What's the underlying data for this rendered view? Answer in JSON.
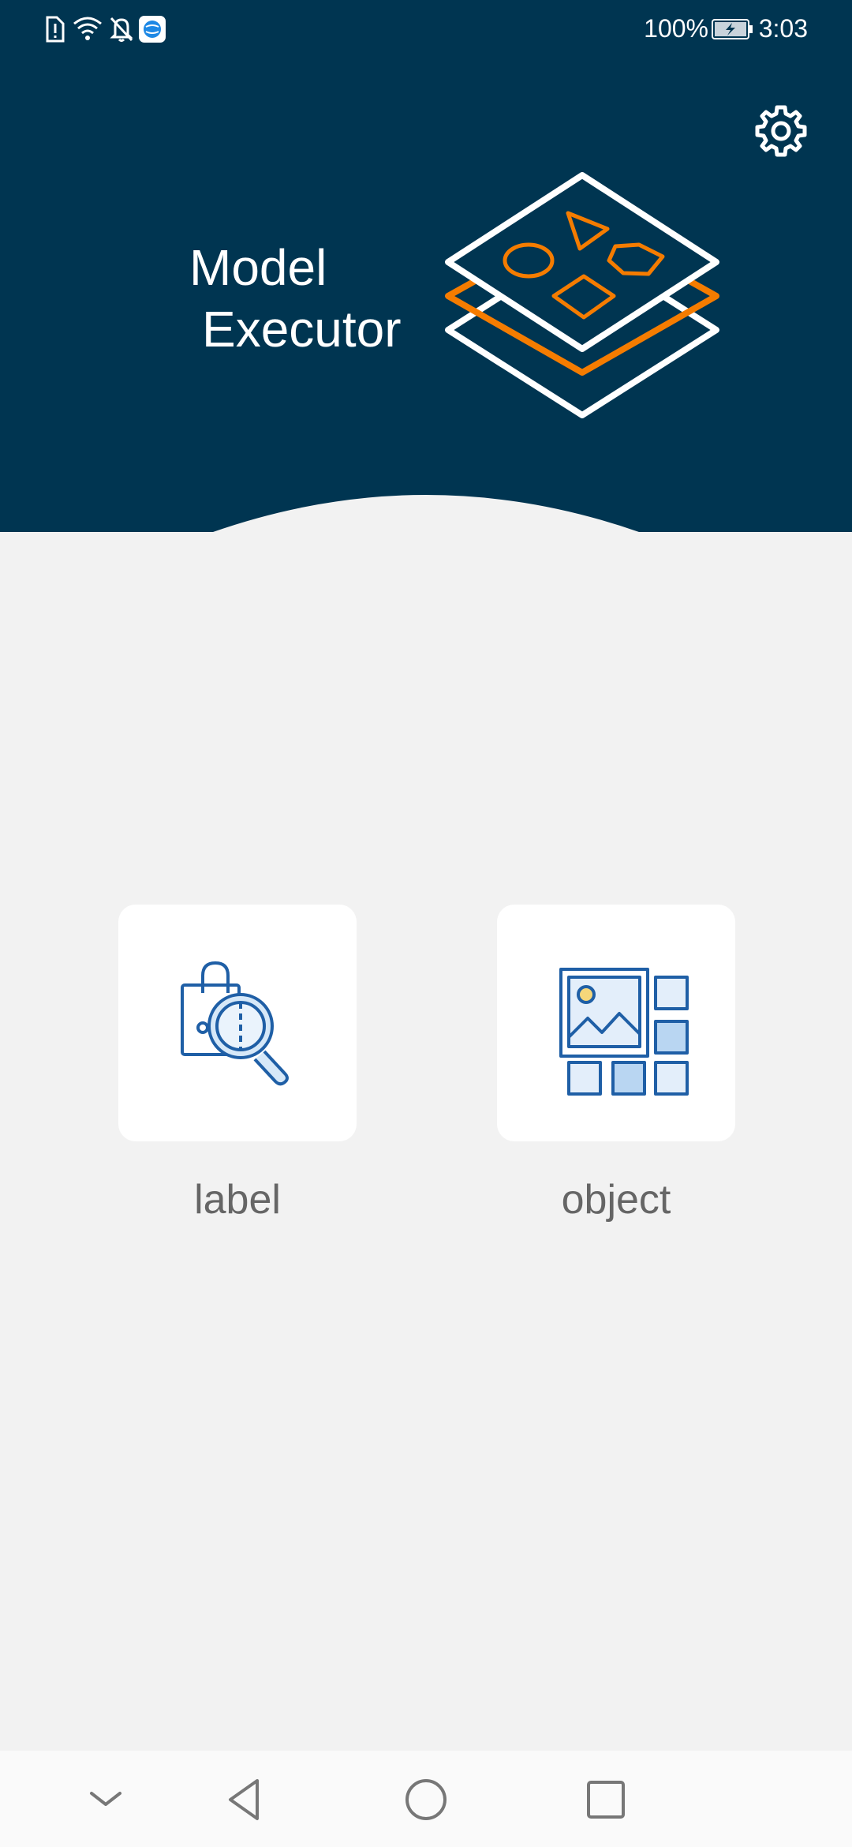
{
  "status_bar": {
    "battery_percent": "100%",
    "time": "3:03",
    "icons": [
      "sim-alert-icon",
      "wifi-icon",
      "bell-muted-icon",
      "browser-app-icon",
      "battery-charging-icon"
    ]
  },
  "header": {
    "title_line1": "Model",
    "title_line2": "Executor",
    "settings_icon": "gear-icon",
    "logo_icon": "stacked-layers-shapes-icon"
  },
  "features": [
    {
      "label": "label",
      "icon": "tag-magnifier-icon"
    },
    {
      "label": "object",
      "icon": "image-grid-icon"
    }
  ],
  "nav_bar": {
    "items": [
      "collapse-chevron-icon",
      "back-triangle-icon",
      "home-circle-icon",
      "recents-square-icon"
    ]
  },
  "colors": {
    "header_bg": "#003551",
    "accent_orange": "#f57c00",
    "page_bg": "#f2f2f2",
    "icon_blue": "#1f5fa6",
    "label_text": "#666666"
  }
}
